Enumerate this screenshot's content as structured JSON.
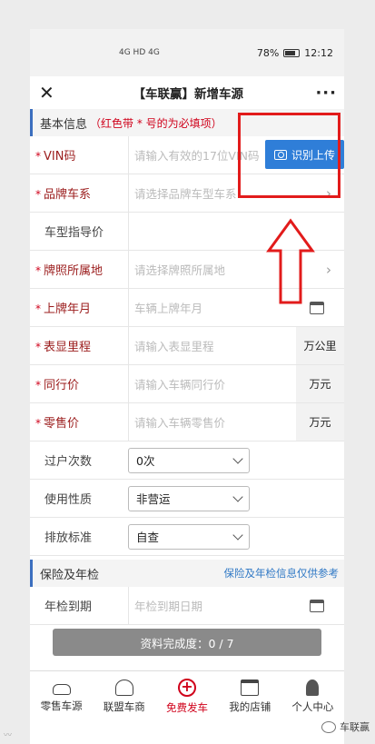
{
  "statusbar": {
    "signal": "4G HD 4G",
    "battery": "78%",
    "time": "12:12"
  },
  "titlebar": {
    "title": "【车联赢】新增车源",
    "back_icon": "close-icon",
    "more": "···"
  },
  "basic": {
    "title": "基本信息",
    "hint": "（红色带 * 号的为必填项）"
  },
  "fields": {
    "vin": {
      "label": "VIN码",
      "placeholder": "请输入有效的17位VIN码",
      "button": "识别上传"
    },
    "brand": {
      "label": "品牌车系",
      "placeholder": "请选择品牌车型车系"
    },
    "guide_price": {
      "label": "车型指导价",
      "placeholder": ""
    },
    "plate_location": {
      "label": "牌照所属地",
      "placeholder": "请选择牌照所属地"
    },
    "plate_date": {
      "label": "上牌年月",
      "placeholder": "车辆上牌年月"
    },
    "mileage": {
      "label": "表显里程",
      "placeholder": "请输入表显里程",
      "unit": "万公里"
    },
    "trade_price": {
      "label": "同行价",
      "placeholder": "请输入车辆同行价",
      "unit": "万元"
    },
    "retail_price": {
      "label": "零售价",
      "placeholder": "请输入车辆零售价",
      "unit": "万元"
    },
    "transfers": {
      "label": "过户次数",
      "value": "0次"
    },
    "usage": {
      "label": "使用性质",
      "value": "非营运"
    },
    "emission": {
      "label": "排放标准",
      "value": "自查"
    }
  },
  "insurance": {
    "title": "保险及年检",
    "link": "保险及年检信息仅供参考",
    "inspect_label": "年检到期",
    "inspect_placeholder": "年检到期日期"
  },
  "progress": {
    "label": "资料完成度：0 / 7"
  },
  "tabs": [
    {
      "label": "零售车源"
    },
    {
      "label": "联盟车商"
    },
    {
      "label": "免费发车"
    },
    {
      "label": "我的店铺"
    },
    {
      "label": "个人中心"
    }
  ],
  "watermark": {
    "right": "车联赢"
  },
  "colors": {
    "accent": "#2f7ed8",
    "required": "#d0021b",
    "annotation": "#e21b1b"
  }
}
